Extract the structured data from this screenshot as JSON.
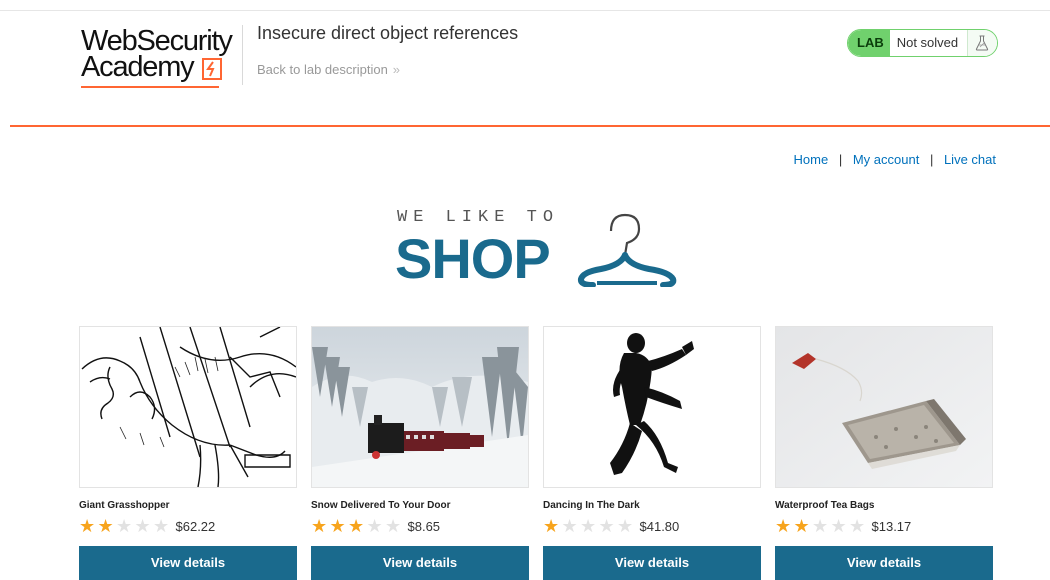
{
  "header": {
    "logo": {
      "line1": "WebSecurity",
      "line2": "Academy"
    },
    "lab_title": "Insecure direct object references",
    "back_link": "Back to lab description",
    "back_chevron": "»",
    "status": {
      "badge": "LAB",
      "text": "Not solved",
      "icon": "flask-icon"
    }
  },
  "nav": {
    "home": "Home",
    "sep1": "|",
    "account": "My account",
    "sep2": "|",
    "chat": "Live chat"
  },
  "shop_logo": {
    "tagline": "WE LIKE TO",
    "word": "SHOP",
    "icon": "hanger-icon"
  },
  "products": [
    {
      "name": "Giant Grasshopper",
      "rating": 2,
      "max_rating": 5,
      "price": "$62.22",
      "button": "View details"
    },
    {
      "name": "Snow Delivered To Your Door",
      "rating": 3,
      "max_rating": 5,
      "price": "$8.65",
      "button": "View details"
    },
    {
      "name": "Dancing In The Dark",
      "rating": 1,
      "max_rating": 5,
      "price": "$41.80",
      "button": "View details"
    },
    {
      "name": "Waterproof Tea Bags",
      "rating": 2,
      "max_rating": 5,
      "price": "$13.17",
      "button": "View details"
    }
  ],
  "colors": {
    "accent": "#ff6633",
    "brand": "#1a6a8d",
    "link": "#0071bc",
    "lab_green": "#70d16d",
    "star": "#f7a41d"
  }
}
